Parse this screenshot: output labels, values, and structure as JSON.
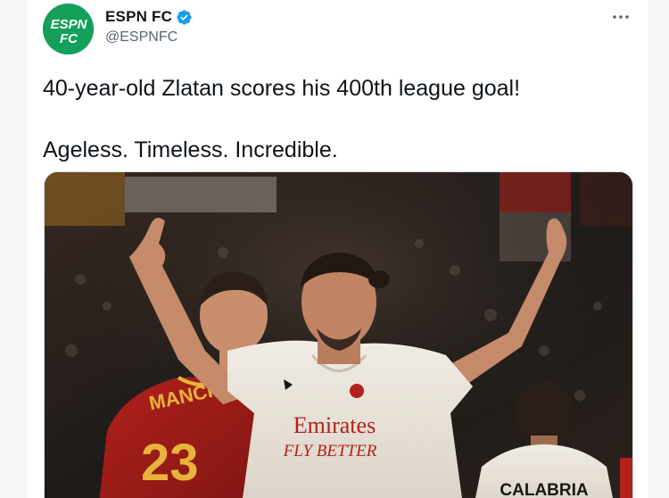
{
  "tweet": {
    "author": {
      "display_name": "ESPN FC",
      "handle": "@ESPNFC",
      "verified": true,
      "avatar_icon": "espn-fc-logo",
      "avatar_logo_text": [
        "ESPN",
        "FC"
      ],
      "avatar_color": "#14a05a"
    },
    "more_icon": "more-horizontal-icon",
    "text_lines": [
      "40-year-old Zlatan scores his 400th league goal!",
      "Ageless. Timeless. Incredible."
    ],
    "media": {
      "jersey_sponsor": "Emirates",
      "jersey_slogan": "FLY BETTER",
      "left_player_name": "MANCINI",
      "left_player_number": "23",
      "right_player_name": "CALABRIA"
    }
  },
  "colors": {
    "verified_blue": "#1d9bf0",
    "text_primary": "#0f1419",
    "text_secondary": "#536471"
  }
}
